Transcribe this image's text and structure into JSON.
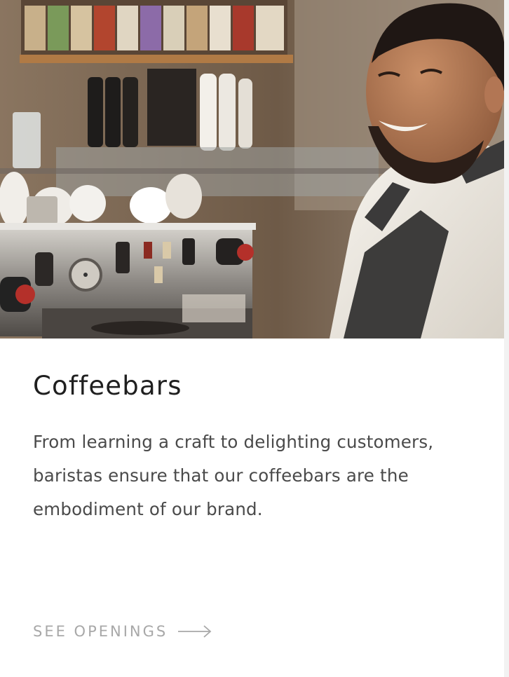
{
  "card": {
    "image_subject": "barista-at-espresso-bar",
    "title": "Coffeebars",
    "description": "From learning a craft to delighting customers, baristas ensure that our coffeebars are the embodiment of our brand.",
    "cta": {
      "label": "SEE OPENINGS",
      "icon": "arrow-right-icon"
    }
  },
  "colors": {
    "title": "#1f1f1f",
    "body_text": "#4a4a4a",
    "cta_text": "#a8a8a8",
    "card_background": "#ffffff",
    "page_background": "#f2f2f2"
  }
}
